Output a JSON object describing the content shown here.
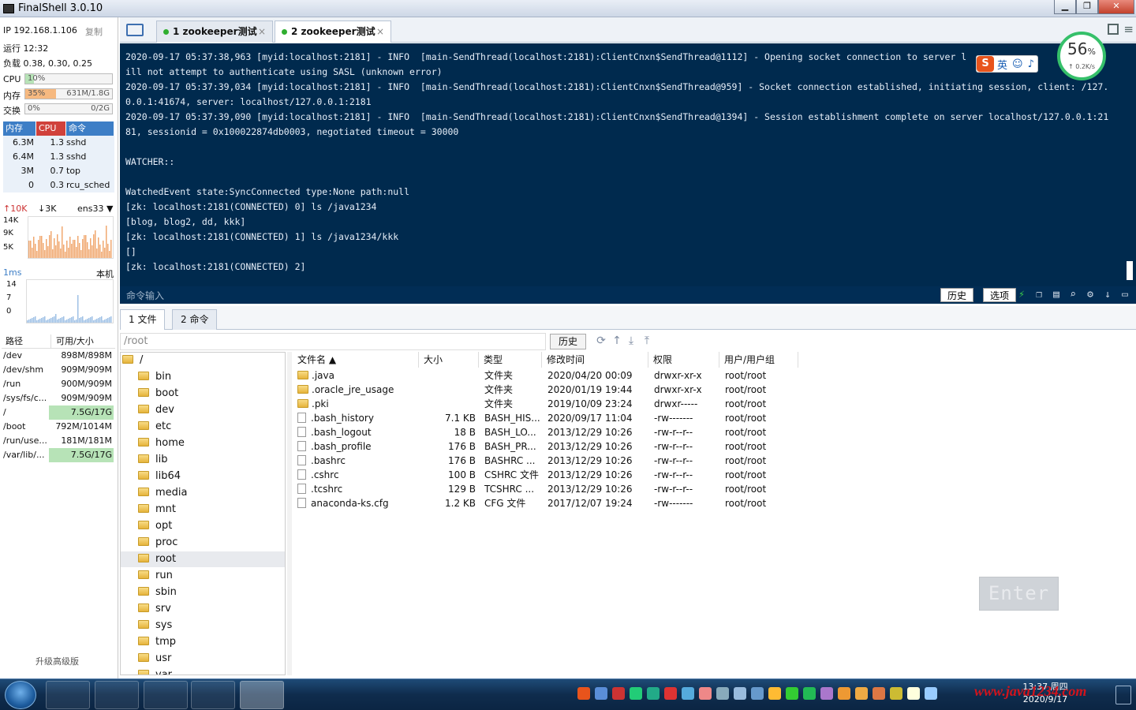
{
  "window": {
    "title": "FinalShell 3.0.10"
  },
  "sidebar": {
    "ip": "IP 192.168.1.106",
    "copy": "复制",
    "uptime": "运行 12:32",
    "load": "负载 0.38, 0.30, 0.25",
    "cpu": {
      "label": "CPU",
      "pct": "10%",
      "frac": 0.1
    },
    "mem": {
      "label": "内存",
      "pct": "35%",
      "val": "631M/1.8G",
      "frac": 0.35
    },
    "swap": {
      "label": "交换",
      "pct": "0%",
      "val": "0/2G",
      "frac": 0
    },
    "proc_headers": [
      "内存",
      "CPU",
      "命令"
    ],
    "procs": [
      {
        "mem": "6.3M",
        "cpu": "1.3",
        "cmd": "sshd"
      },
      {
        "mem": "6.4M",
        "cpu": "1.3",
        "cmd": "sshd"
      },
      {
        "mem": "3M",
        "cpu": "0.7",
        "cmd": "top"
      },
      {
        "mem": "0",
        "cpu": "0.3",
        "cmd": "rcu_sched"
      }
    ],
    "net": {
      "up": "10K",
      "down": "3K",
      "iface": "ens33",
      "ticks": [
        "14K",
        "9K",
        "5K"
      ]
    },
    "ping": {
      "label": "1ms",
      "host": "本机",
      "ticks": [
        "14",
        "7",
        "0"
      ]
    },
    "disk_headers": [
      "路径",
      "可用/大小"
    ],
    "disks": [
      {
        "path": "/dev",
        "val": "898M/898M"
      },
      {
        "path": "/dev/shm",
        "val": "909M/909M"
      },
      {
        "path": "/run",
        "val": "900M/909M"
      },
      {
        "path": "/sys/fs/c...",
        "val": "909M/909M"
      },
      {
        "path": "/",
        "val": "7.5G/17G"
      },
      {
        "path": "/boot",
        "val": "792M/1014M"
      },
      {
        "path": "/run/use...",
        "val": "181M/181M"
      },
      {
        "path": "/var/lib/...",
        "val": "7.5G/17G"
      }
    ],
    "upgrade": "升级高级版"
  },
  "tabs": [
    {
      "label": "1 zookeeper测试"
    },
    {
      "label": "2 zookeeper测试"
    }
  ],
  "terminal": {
    "lines": [
      "2020-09-17 05:37:38,963 [myid:localhost:2181] - INFO  [main-SendThread(localhost:2181):ClientCnxn$SendThread@1112] - Opening socket connection to server l",
      "ill not attempt to authenticate using SASL (unknown error)",
      "2020-09-17 05:37:39,034 [myid:localhost:2181] - INFO  [main-SendThread(localhost:2181):ClientCnxn$SendThread@959] - Socket connection established, initiating session, client: /127.",
      "0.0.1:41674, server: localhost/127.0.0.1:2181",
      "2020-09-17 05:37:39,090 [myid:localhost:2181] - INFO  [main-SendThread(localhost:2181):ClientCnxn$SendThread@1394] - Session establishment complete on server localhost/127.0.0.1:21",
      "81, sessionid = 0x100022874db0003, negotiated timeout = 30000",
      "",
      "WATCHER::",
      "",
      "WatchedEvent state:SyncConnected type:None path:null",
      "[zk: localhost:2181(CONNECTED) 0] ls /java1234",
      "[blog, blog2, dd, kkk]",
      "[zk: localhost:2181(CONNECTED) 1] ls /java1234/kkk",
      "[]",
      "[zk: localhost:2181(CONNECTED) 2]"
    ],
    "cmd_placeholder": "命令输入",
    "history": "历史",
    "options": "选项"
  },
  "ime": {
    "logo": "S",
    "lang": "英"
  },
  "speed": {
    "pct": "56",
    "unit": "%",
    "rate": "↑ 0.2K/s"
  },
  "file_tabs": [
    "1 文件",
    "2 命令"
  ],
  "path": {
    "value": "/root",
    "history": "历史"
  },
  "tree": {
    "root": "/",
    "items": [
      "bin",
      "boot",
      "dev",
      "etc",
      "home",
      "lib",
      "lib64",
      "media",
      "mnt",
      "opt",
      "proc",
      "root",
      "run",
      "sbin",
      "srv",
      "sys",
      "tmp",
      "usr",
      "var"
    ]
  },
  "files": {
    "headers": [
      "文件名",
      "大小",
      "类型",
      "修改时间",
      "权限",
      "用户/用户组"
    ],
    "rows": [
      {
        "name": ".java",
        "size": "",
        "type": "文件夹",
        "time": "2020/04/20 00:09",
        "perm": "drwxr-xr-x",
        "owner": "root/root",
        "dir": true
      },
      {
        "name": ".oracle_jre_usage",
        "size": "",
        "type": "文件夹",
        "time": "2020/01/19 19:44",
        "perm": "drwxr-xr-x",
        "owner": "root/root",
        "dir": true
      },
      {
        "name": ".pki",
        "size": "",
        "type": "文件夹",
        "time": "2019/10/09 23:24",
        "perm": "drwxr-----",
        "owner": "root/root",
        "dir": true
      },
      {
        "name": ".bash_history",
        "size": "7.1 KB",
        "type": "BASH_HIS...",
        "time": "2020/09/17 11:04",
        "perm": "-rw-------",
        "owner": "root/root",
        "dir": false
      },
      {
        "name": ".bash_logout",
        "size": "18 B",
        "type": "BASH_LO...",
        "time": "2013/12/29 10:26",
        "perm": "-rw-r--r--",
        "owner": "root/root",
        "dir": false
      },
      {
        "name": ".bash_profile",
        "size": "176 B",
        "type": "BASH_PR...",
        "time": "2013/12/29 10:26",
        "perm": "-rw-r--r--",
        "owner": "root/root",
        "dir": false
      },
      {
        "name": ".bashrc",
        "size": "176 B",
        "type": "BASHRC ...",
        "time": "2013/12/29 10:26",
        "perm": "-rw-r--r--",
        "owner": "root/root",
        "dir": false
      },
      {
        "name": ".cshrc",
        "size": "100 B",
        "type": "CSHRC 文件",
        "time": "2013/12/29 10:26",
        "perm": "-rw-r--r--",
        "owner": "root/root",
        "dir": false
      },
      {
        "name": ".tcshrc",
        "size": "129 B",
        "type": "TCSHRC ...",
        "time": "2013/12/29 10:26",
        "perm": "-rw-r--r--",
        "owner": "root/root",
        "dir": false
      },
      {
        "name": "anaconda-ks.cfg",
        "size": "1.2 KB",
        "type": "CFG 文件",
        "time": "2017/12/07 19:24",
        "perm": "-rw-------",
        "owner": "root/root",
        "dir": false
      }
    ]
  },
  "enter_overlay": "Enter",
  "taskbar": {
    "time": "13:37 周四",
    "date": "2020/9/17",
    "watermark": "www.java1234.com"
  },
  "colors": {
    "terminal_bg": "#002a4e",
    "accent": "#3d7ec6",
    "cpu_fill": "#b7e3b7",
    "mem_fill": "#f6b980"
  }
}
